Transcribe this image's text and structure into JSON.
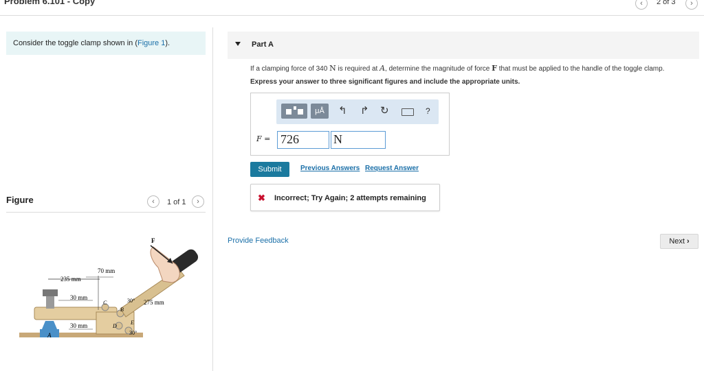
{
  "header": {
    "title": "Problem 6.101 - Copy",
    "pager": "2 of 3",
    "prev_icon": "chevron-left-icon",
    "next_icon": "chevron-right-icon"
  },
  "intro": {
    "text": "Consider the toggle clamp shown in (",
    "link": "Figure 1",
    "suffix": ")."
  },
  "figure": {
    "label": "Figure",
    "pager": "1 of 1",
    "labels": {
      "F": "F",
      "d235": "235 mm",
      "d70": "70 mm",
      "d30a": "30 mm",
      "d30b": "30 mm",
      "d275": "275 mm",
      "a30a": "30°",
      "a30b": "30°",
      "A": "A",
      "B": "B",
      "C": "C",
      "D": "D",
      "E": "E"
    }
  },
  "part": {
    "title": "Part A",
    "question_1": "If a clamping force of 340 ",
    "question_unit": "N",
    "question_2": " is required at ",
    "question_A": "A",
    "question_3": ", determine the magnitude of force ",
    "question_F": "F",
    "question_4": " that must be applied to the handle of the toggle clamp.",
    "instruction": "Express your answer to three significant figures and include the appropriate units.",
    "toolbar": {
      "templates_icon": "templates-icon",
      "units_label": "μÅ",
      "undo_icon": "undo-icon",
      "redo_icon": "redo-icon",
      "reset_icon": "reset-icon",
      "keyboard_icon": "keyboard-icon",
      "help_label": "?"
    },
    "variable": "F",
    "equals": "=",
    "value": "726",
    "unit": "N",
    "submit": "Submit",
    "previous_answers": "Previous Answers",
    "request_answer": "Request Answer",
    "feedback": "Incorrect; Try Again; 2 attempts remaining"
  },
  "footer": {
    "provide_feedback": "Provide Feedback",
    "next": "Next"
  },
  "colors": {
    "accent": "#1b7a9e",
    "link": "#1a6fa8",
    "error": "#c8102e",
    "intro_bg": "#e8f5f6"
  }
}
